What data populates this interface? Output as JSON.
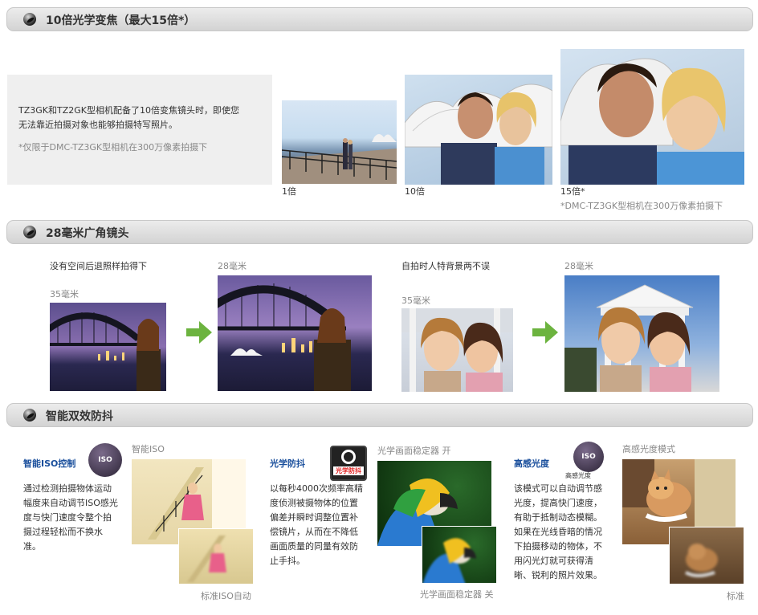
{
  "sections": {
    "zoom": {
      "title": "10倍光学变焦（最大15倍*）",
      "desc1": "TZ3GK和TZ2GK型相机配备了10倍变焦镜头时，即使您",
      "desc2": "无法靠近拍摄对象也能够拍摄特写照片。",
      "note": "*仅限于DMC-TZ3GK型相机在300万像素拍摄下",
      "captions": [
        "1倍",
        "10倍",
        "15倍*"
      ],
      "caption_note": "*DMC-TZ3GK型相机在300万像素拍摄下"
    },
    "wide": {
      "title": "28毫米广角镜头",
      "left_heading": "没有空间后退照样拍得下",
      "right_heading": "自拍时人特背景两不误",
      "label_35": "35毫米",
      "label_28": "28毫米"
    },
    "stab": {
      "title": "智能双效防抖",
      "iso": {
        "heading": "智能ISO控制",
        "body": [
          "通过检测拍摄物体运动",
          "幅度来自动调节ISO感光",
          "度与快门速度令整个拍",
          "摄过程轻松而不换水",
          "准。"
        ],
        "img_top": "智能ISO",
        "img_bottom": "标准ISO自动",
        "badge": "ISO"
      },
      "ois": {
        "heading": "光学防抖",
        "body": [
          "以每秒4000次频率高精",
          "度侦测被摄物体的位置",
          "偏差并瞬时调整位置补",
          "偿镜片，从而在不降低",
          "画面质量的同量有效防",
          "止手抖。"
        ],
        "img_top": "光学画面稳定器 开",
        "img_bottom": "光学画面稳定器 关",
        "badge": "光学防抖"
      },
      "high": {
        "heading": "高感光度",
        "body": [
          "该模式可以自动调节感",
          "光度，提高快门速度，",
          "有助于抵制动态模糊。",
          "如果在光线昏暗的情况",
          "下拍摄移动的物体，不",
          "用闪光灯就可获得清",
          "晰、锐利的照片效果。"
        ],
        "img_top": "高感光度模式",
        "img_bottom": "标准",
        "badge": "ISO",
        "badge_label": "高感光度"
      }
    }
  },
  "colors": {
    "arrow": "#6cb33f",
    "accent_blue": "#1a4f9c"
  }
}
